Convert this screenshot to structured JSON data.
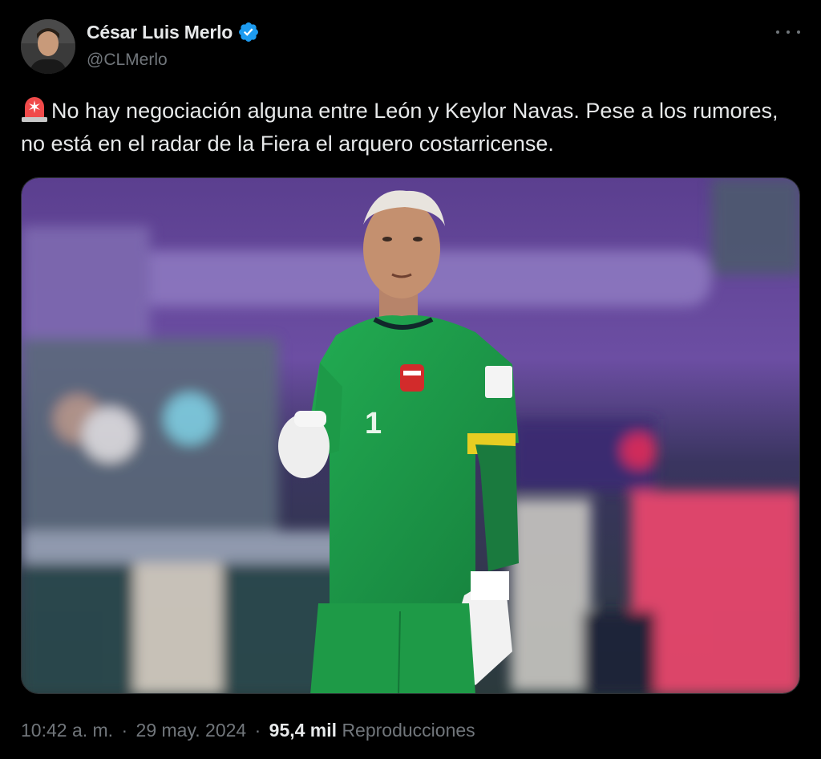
{
  "author": {
    "name": "César Luis Merlo",
    "handle": "@CLMerlo",
    "verified": true,
    "verified_color": "#1d9bf0"
  },
  "tweet": {
    "emoji": "siren-icon",
    "text": "No hay negociación alguna entre León y Keylor Navas. Pese a los rumores, no está en el radar de la Fiera el arquero costarricense."
  },
  "media": {
    "description": "photo",
    "jersey_number": "1"
  },
  "meta": {
    "time": "10:42 a. m.",
    "separator": "·",
    "date": "29 may. 2024",
    "views_count": "95,4 mil",
    "views_label": "Reproducciones"
  },
  "colors": {
    "background": "#000000",
    "text_primary": "#e7e9ea",
    "text_secondary": "#71767b",
    "verified": "#1d9bf0",
    "kit_green": "#1f9e4a"
  }
}
